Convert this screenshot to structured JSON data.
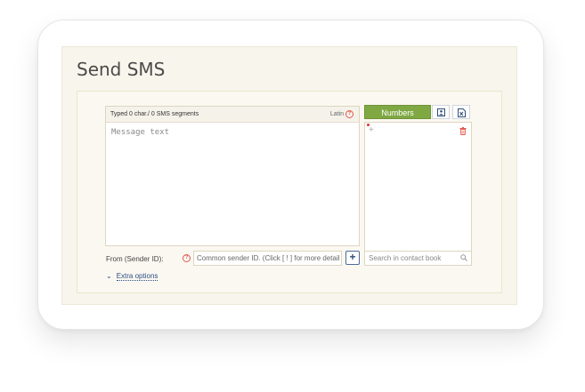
{
  "page": {
    "title": "Send SMS"
  },
  "message": {
    "counter_text": "Typed 0 char./ 0 SMS segments",
    "encoding_label": "Latin",
    "help_glyph": "?",
    "placeholder": "Message text"
  },
  "recipients": {
    "tab_numbers_label": "Numbers",
    "contacts_icon": "contact-book-icon",
    "excel_icon": "excel-file-icon",
    "add_glyph": "+",
    "search_placeholder": "Search in contact book"
  },
  "sender": {
    "label": "From (Sender ID):",
    "help_glyph": "?",
    "placeholder": "Common sender ID. (Click [ ! ] for more details",
    "add_glyph": "+"
  },
  "extra": {
    "label": "Extra options"
  },
  "colors": {
    "accent_green": "#7fa843",
    "link_blue": "#2b4f86",
    "help_red": "#e05a4f"
  }
}
